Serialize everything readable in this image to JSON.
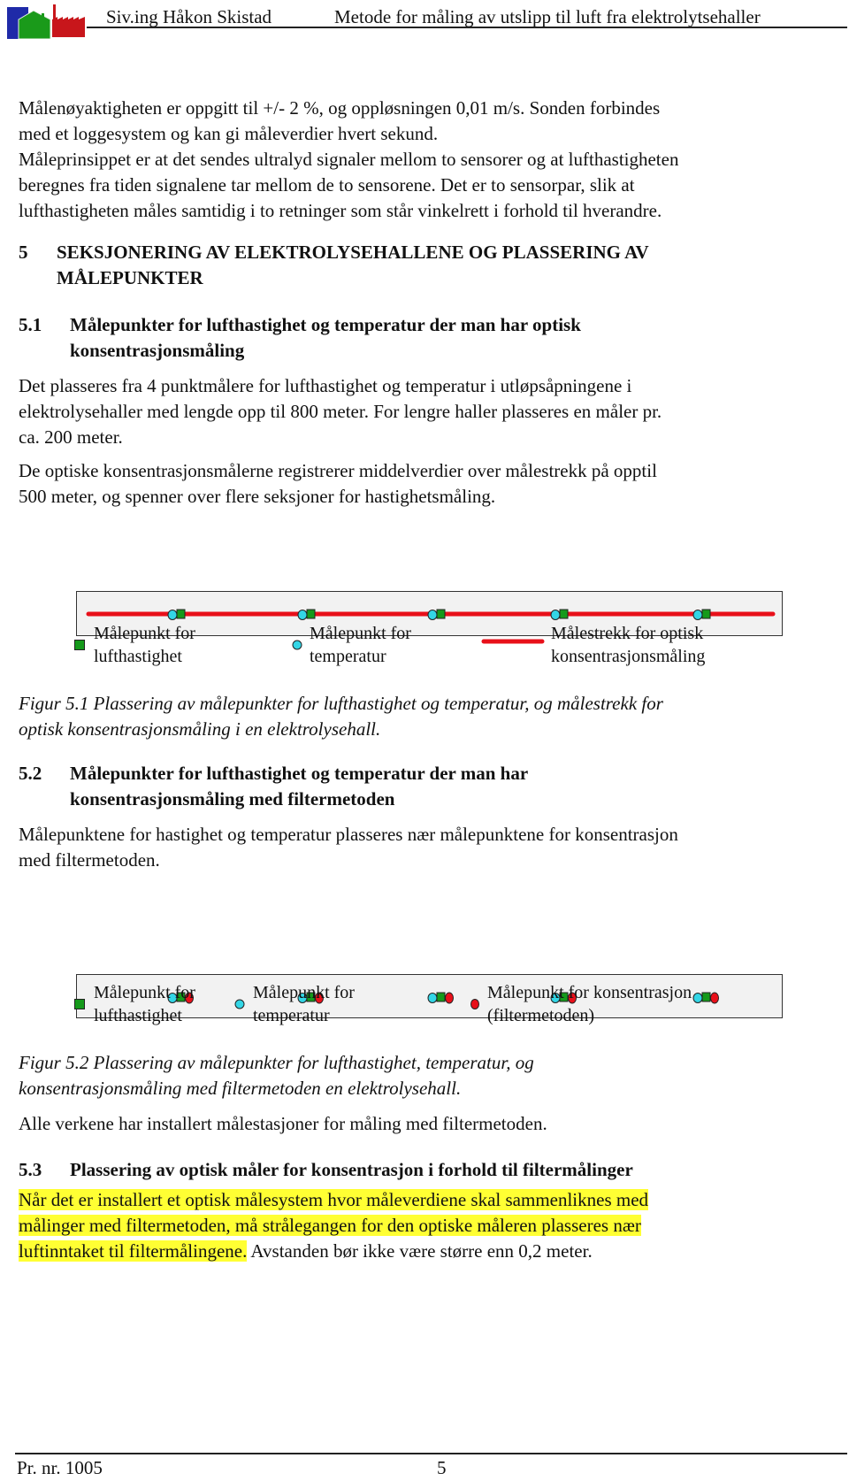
{
  "header": {
    "author": "Siv.ing Håkon Skistad",
    "title": "Metode for måling av utslipp til luft fra elektrolytsehaller",
    "logo_icon": "factory-logo-icon"
  },
  "body": {
    "intro_lines": [
      "Målenøyaktigheten er oppgitt til +/- 2 %, og oppløsningen 0,01 m/s. Sonden forbindes",
      "med et loggesystem og kan gi måleverdier hvert sekund.",
      "Måleprinsippet er at det sendes ultralyd signaler mellom to sensorer og at lufthastigheten",
      "beregnes fra tiden signalene tar mellom de to sensorene. Det er to sensorpar, slik at",
      "lufthastigheten måles samtidig i to retninger som står vinkelrett i forhold til hverandre."
    ],
    "section5": {
      "number": "5",
      "title_line1": "SEKSJONERING AV ELEKTROLYSEHALLENE OG PLASSERING AV",
      "title_line2": "MÅLEPUNKTER"
    },
    "section51": {
      "number": "5.1",
      "title_line1": "Målepunkter for lufthastighet og temperatur der man har optisk",
      "title_line2": "konsentrasjonsmåling",
      "para1": [
        "Det plasseres fra 4 punktmålere for lufthastighet og temperatur i utløpsåpningene i",
        "elektrolysehaller med lengde opp til 800 meter. For lengre haller plasseres en måler pr.",
        "ca. 200 meter."
      ],
      "para2": [
        "De optiske konsentrasjonsmålerne registrerer middelverdier over målestrekk på opptil",
        "500 meter, og spenner over flere seksjoner for hastighetsmåling."
      ]
    },
    "figure1": {
      "marker_count": 5,
      "legend": [
        {
          "icon": "green-square-icon",
          "line1": "Målepunkt for",
          "line2": "lufthastighet"
        },
        {
          "icon": "cyan-circle-icon",
          "line1": "Målepunkt for",
          "line2": "temperatur"
        },
        {
          "icon": "red-line-icon",
          "line1": "Målestrekk for optisk",
          "line2": "konsentrasjonsmåling"
        }
      ],
      "caption_line1": "Figur 5.1 Plassering av målepunkter for lufthastighet og temperatur, og målestrekk for",
      "caption_line2": "optisk konsentrasjonsmåling i en elektrolysehall."
    },
    "section52": {
      "number": "5.2",
      "title_line1": "Målepunkter for lufthastighet og temperatur der man har",
      "title_line2": "konsentrasjonsmåling med filtermetoden",
      "para": [
        "Målepunktene for hastighet og temperatur plasseres nær målepunktene for konsentrasjon",
        "med filtermetoden."
      ]
    },
    "figure2": {
      "marker_count": 5,
      "legend": [
        {
          "icon": "green-square-icon",
          "line1": "Målepunkt for",
          "line2": "lufthastighet"
        },
        {
          "icon": "cyan-circle-icon",
          "line1": "Målepunkt for",
          "line2": "temperatur"
        },
        {
          "icon": "red-circle-icon",
          "line1": "Målepunkt for konsentrasjon",
          "line2": "(filtermetoden)"
        }
      ],
      "caption_line1": "Figur 5.2 Plassering av målepunkter for lufthastighet, temperatur, og",
      "caption_line2": "konsentrasjonsmåling med filtermetoden en elektrolysehall.",
      "after": "Alle verkene har installert målestasjoner for måling med filtermetoden."
    },
    "section53": {
      "number": "5.3",
      "title": "Plassering av optisk måler for konsentrasjon i forhold til filtermålinger",
      "highlighted_lines": [
        "Når det er installert et optisk målesystem hvor måleverdiene skal sammenliknes med",
        "målinger med filtermetoden, må strålegangen for den optiske måleren plasseres nær",
        "luftinntaket til filtermålingene."
      ],
      "rest": " Avstanden bør ikke være større enn 0,2 meter."
    }
  },
  "footer": {
    "project": "Pr. nr. 1005",
    "page": "5"
  },
  "colors": {
    "green": "#159a1b",
    "cyan": "#33d6e6",
    "red": "#e8101a",
    "highlight": "#ffff33"
  }
}
